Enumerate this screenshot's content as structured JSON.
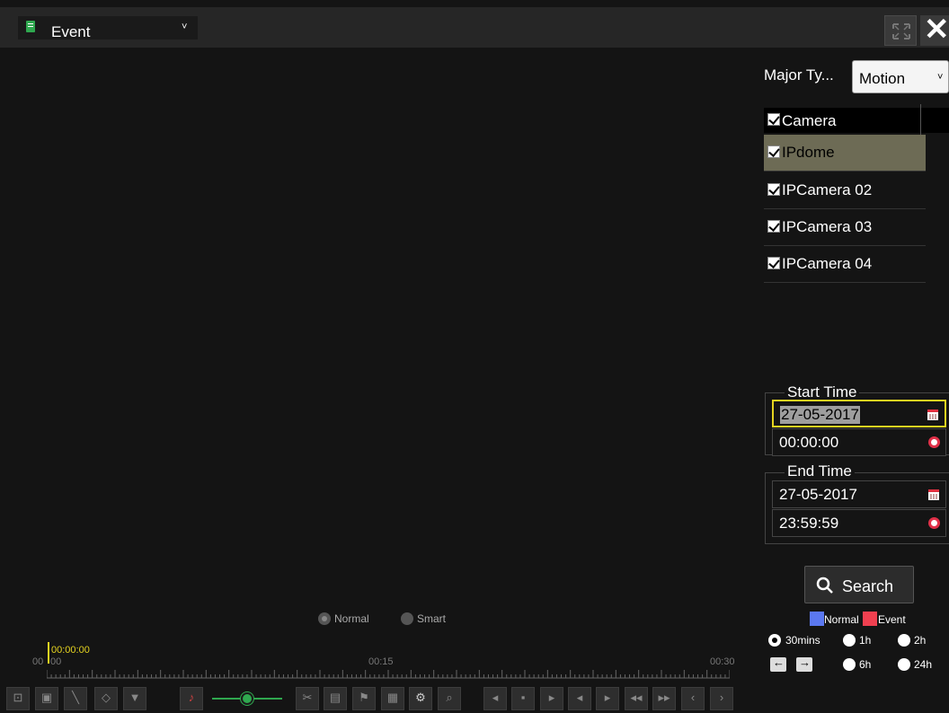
{
  "header": {
    "mode_label": "Event",
    "mode_arrow": "˅",
    "close_symbol": "✕"
  },
  "filter": {
    "major_type_label": "Major Ty...",
    "major_type_value": "Motion",
    "major_type_arrow": "˅"
  },
  "cameras": {
    "header_label": "Camera",
    "items": [
      {
        "label": "IPdome",
        "checked": true,
        "selected": true
      },
      {
        "label": "IPCamera 02",
        "checked": true,
        "selected": false
      },
      {
        "label": "IPCamera 03",
        "checked": true,
        "selected": false
      },
      {
        "label": "IPCamera 04",
        "checked": true,
        "selected": false
      }
    ]
  },
  "start_time": {
    "title": "Start Time",
    "date": "27-05-2017",
    "time": "00:00:00"
  },
  "end_time": {
    "title": "End Time",
    "date": "27-05-2017",
    "time": "23:59:59"
  },
  "search": {
    "label": "Search"
  },
  "legend": {
    "normal_label": "Normal",
    "event_label": "Event",
    "normal_color": "#5b78f0",
    "event_color": "#f04050"
  },
  "zoom": {
    "options": [
      "30mins",
      "1h",
      "2h",
      "6h",
      "24h"
    ],
    "selected": "30mins",
    "prev_arrow": "←",
    "next_arrow": "→"
  },
  "playback_mode": {
    "normal_label": "Normal",
    "smart_label": "Smart",
    "selected": "Normal"
  },
  "timeline": {
    "cursor_time": "00:00:00",
    "left_edge_label": "00",
    "start_label": "00",
    "mid_label": "00:15",
    "end_label": "00:30",
    "cursor_color": "#e5d320"
  },
  "toolbar": {
    "buttons": [
      {
        "name": "full-frame-icon",
        "glyph": "⊡"
      },
      {
        "name": "digital-zoom-icon",
        "glyph": "▣"
      },
      {
        "name": "draw-line-icon",
        "glyph": "╲"
      },
      {
        "name": "ptz-icon",
        "glyph": "◇"
      },
      {
        "name": "filter-icon",
        "glyph": "▼"
      },
      {
        "name": "mute-icon",
        "glyph": "♪"
      },
      {
        "name": "clip-icon",
        "glyph": "✂"
      },
      {
        "name": "snapshot-icon",
        "glyph": "▤"
      },
      {
        "name": "tag-icon",
        "glyph": "⚑"
      },
      {
        "name": "add-tag-icon",
        "glyph": "▦"
      },
      {
        "name": "settings-icon",
        "glyph": "⚙"
      },
      {
        "name": "zoom-search-icon",
        "glyph": "⌕"
      },
      {
        "name": "reverse-play-icon",
        "glyph": "◂"
      },
      {
        "name": "stop-icon",
        "glyph": "▪"
      },
      {
        "name": "play-icon",
        "glyph": "▸"
      },
      {
        "name": "rewind-30s-icon",
        "glyph": "◂"
      },
      {
        "name": "forward-30s-icon",
        "glyph": "▸"
      },
      {
        "name": "slow-icon",
        "glyph": "◂◂"
      },
      {
        "name": "fast-icon",
        "glyph": "▸▸"
      },
      {
        "name": "prev-icon",
        "glyph": "‹"
      },
      {
        "name": "next-icon",
        "glyph": "›"
      }
    ]
  }
}
